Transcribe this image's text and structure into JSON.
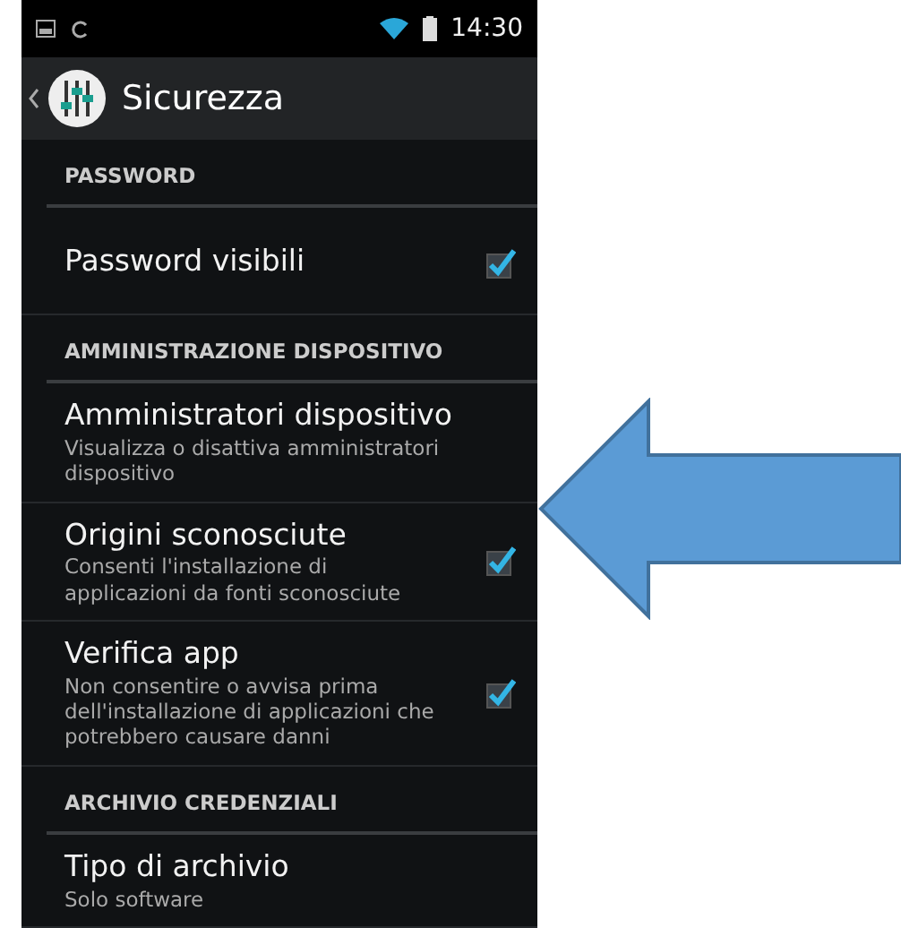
{
  "status_bar": {
    "time": "14:30"
  },
  "action_bar": {
    "title": "Sicurezza"
  },
  "items": [
    {
      "kind": "header",
      "title": "PASSWORD"
    },
    {
      "kind": "checkbox",
      "title": "Password visibili",
      "checked": true
    },
    {
      "kind": "header",
      "title": "AMMINISTRAZIONE DISPOSITIVO"
    },
    {
      "kind": "plain",
      "title": "Amministratori dispositivo",
      "summary": "Visualizza o disattiva amministratori dispositivo"
    },
    {
      "kind": "checkbox",
      "title": "Origini sconosciute",
      "summary": "Consenti l'installazione di applicazioni da fonti sconosciute",
      "checked": true
    },
    {
      "kind": "checkbox",
      "title": "Verifica app",
      "summary": "Non consentire o avvisa prima dell'installazione di applicazioni che potrebbero causare danni",
      "checked": true
    },
    {
      "kind": "header",
      "title": "ARCHIVIO CREDENZIALI"
    },
    {
      "kind": "plain",
      "title": "Tipo di archivio",
      "summary": "Solo software"
    }
  ]
}
